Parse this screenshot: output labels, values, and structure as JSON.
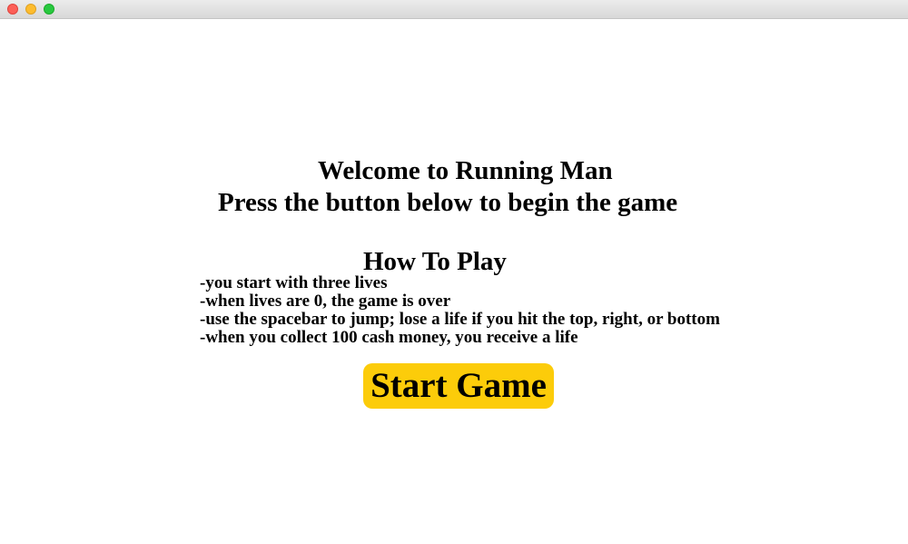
{
  "window": {
    "controls": [
      "close",
      "minimize",
      "maximize"
    ]
  },
  "welcome": {
    "line1": "Welcome to Running Man",
    "line2": "Press the button below to begin the game"
  },
  "how_to_play": {
    "title": "How To Play",
    "rules": [
      "-you start with three lives",
      "-when lives are 0, the game is over",
      "-use the spacebar to jump; lose a life if you hit the top, right, or bottom",
      "-when you collect 100 cash money, you receive a life"
    ]
  },
  "start_button": {
    "label": "Start Game",
    "color": "#fccc0a"
  }
}
